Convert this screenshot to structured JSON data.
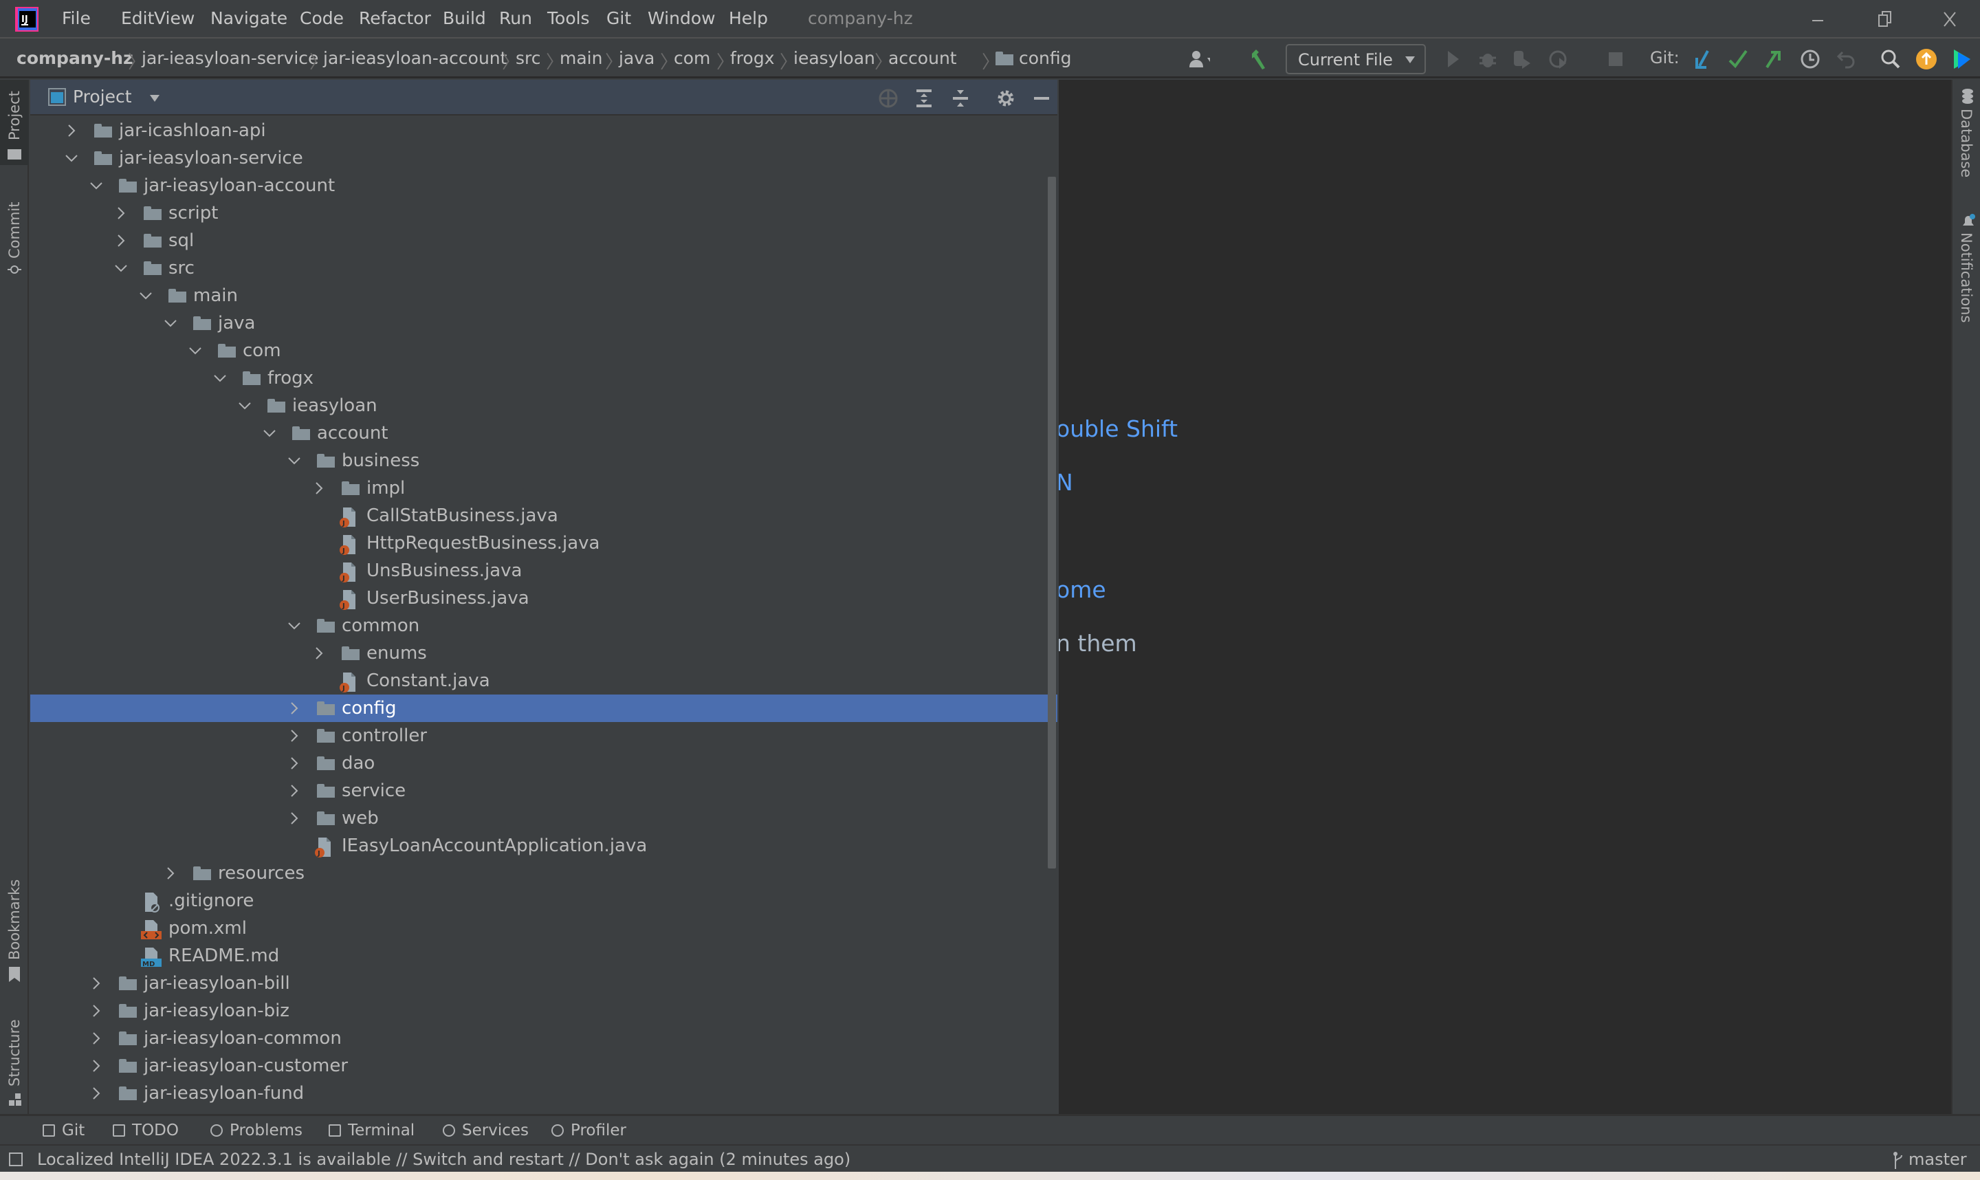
{
  "window": {
    "title": "company-hz",
    "app_icon": "intellij-idea-icon",
    "controls": [
      "minimize-icon",
      "restore-icon",
      "close-icon"
    ]
  },
  "menu": [
    "File",
    "Edit",
    "View",
    "Navigate",
    "Code",
    "Refactor",
    "Build",
    "Run",
    "Tools",
    "Git",
    "Window",
    "Help"
  ],
  "breadcrumb": [
    "company-hz",
    "jar-ieasyloan-service",
    "jar-ieasyloan-account",
    "src",
    "main",
    "java",
    "com",
    "frogx",
    "ieasyloan",
    "account",
    "config"
  ],
  "toolbar": {
    "run_config": "Current File",
    "git_label": "Git:"
  },
  "colors": {
    "accent": "#4b6eaf",
    "link": "#589df6",
    "java_badge": "#c75625",
    "xml_badge": "#c75625",
    "md_badge": "#3592c4",
    "vcs_update": "#3592c4",
    "vcs_green": "#499c54",
    "update_orange": "#f0a732"
  },
  "left_strip": {
    "project": "Project",
    "commit": "Commit",
    "bookmarks": "Bookmarks",
    "structure": "Structure"
  },
  "right_strip": {
    "database": "Database",
    "notifications": "Notifications"
  },
  "project_panel": {
    "title": "Project"
  },
  "tree": [
    {
      "label": "jar-icashloan-api",
      "level": 0,
      "type": "folder",
      "state": "collapsed"
    },
    {
      "label": "jar-ieasyloan-service",
      "level": 0,
      "type": "folder",
      "state": "expanded"
    },
    {
      "label": "jar-ieasyloan-account",
      "level": 1,
      "type": "folder",
      "state": "expanded"
    },
    {
      "label": "script",
      "level": 2,
      "type": "folder",
      "state": "collapsed"
    },
    {
      "label": "sql",
      "level": 2,
      "type": "folder",
      "state": "collapsed"
    },
    {
      "label": "src",
      "level": 2,
      "type": "folder",
      "state": "expanded"
    },
    {
      "label": "main",
      "level": 3,
      "type": "folder",
      "state": "expanded"
    },
    {
      "label": "java",
      "level": 4,
      "type": "folder",
      "state": "expanded"
    },
    {
      "label": "com",
      "level": 5,
      "type": "folder",
      "state": "expanded"
    },
    {
      "label": "frogx",
      "level": 6,
      "type": "folder",
      "state": "expanded"
    },
    {
      "label": "ieasyloan",
      "level": 7,
      "type": "folder",
      "state": "expanded"
    },
    {
      "label": "account",
      "level": 8,
      "type": "folder",
      "state": "expanded"
    },
    {
      "label": "business",
      "level": 9,
      "type": "folder",
      "state": "expanded"
    },
    {
      "label": "impl",
      "level": 10,
      "type": "folder",
      "state": "collapsed"
    },
    {
      "label": "CallStatBusiness.java",
      "level": 10,
      "type": "java"
    },
    {
      "label": "HttpRequestBusiness.java",
      "level": 10,
      "type": "java"
    },
    {
      "label": "UnsBusiness.java",
      "level": 10,
      "type": "java"
    },
    {
      "label": "UserBusiness.java",
      "level": 10,
      "type": "java"
    },
    {
      "label": "common",
      "level": 9,
      "type": "folder",
      "state": "expanded"
    },
    {
      "label": "enums",
      "level": 10,
      "type": "folder",
      "state": "collapsed"
    },
    {
      "label": "Constant.java",
      "level": 10,
      "type": "java"
    },
    {
      "label": "config",
      "level": 9,
      "type": "folder",
      "state": "collapsed",
      "selected": true
    },
    {
      "label": "controller",
      "level": 9,
      "type": "folder",
      "state": "collapsed"
    },
    {
      "label": "dao",
      "level": 9,
      "type": "folder",
      "state": "collapsed"
    },
    {
      "label": "service",
      "level": 9,
      "type": "folder",
      "state": "collapsed"
    },
    {
      "label": "web",
      "level": 9,
      "type": "folder",
      "state": "collapsed"
    },
    {
      "label": "IEasyLoanAccountApplication.java",
      "level": 9,
      "type": "java"
    },
    {
      "label": "resources",
      "level": 4,
      "type": "folder",
      "state": "collapsed"
    },
    {
      "label": ".gitignore",
      "level": 2,
      "type": "gitignore"
    },
    {
      "label": "pom.xml",
      "level": 2,
      "type": "xml"
    },
    {
      "label": "README.md",
      "level": 2,
      "type": "md"
    },
    {
      "label": "jar-ieasyloan-bill",
      "level": 1,
      "type": "folder",
      "state": "collapsed"
    },
    {
      "label": "jar-ieasyloan-biz",
      "level": 1,
      "type": "folder",
      "state": "collapsed"
    },
    {
      "label": "jar-ieasyloan-common",
      "level": 1,
      "type": "folder",
      "state": "collapsed"
    },
    {
      "label": "jar-ieasyloan-customer",
      "level": 1,
      "type": "folder",
      "state": "collapsed"
    },
    {
      "label": "jar-ieasyloan-fund",
      "level": 1,
      "type": "folder",
      "state": "collapsed"
    }
  ],
  "editor_hints": [
    {
      "text": "ouble Shift",
      "link": true
    },
    {
      "text": "N",
      "link": true
    },
    {
      "text": "ome",
      "link": true
    },
    {
      "text": "n them",
      "link": false
    }
  ],
  "tool_tabs": [
    "Git",
    "TODO",
    "Problems",
    "Terminal",
    "Services",
    "Profiler"
  ],
  "status": {
    "message": "Localized IntelliJ IDEA 2022.3.1 is available // Switch and restart // Don't ask again (2 minutes ago)",
    "branch": "master"
  }
}
